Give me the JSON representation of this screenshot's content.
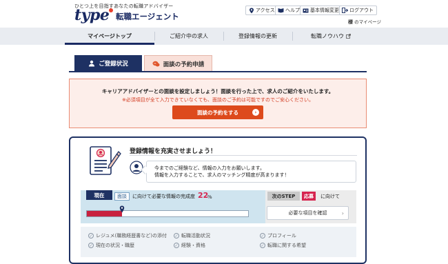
{
  "header": {
    "tagline": "ひとつ上を目指すあなたの転職アドバイザー",
    "logo_main": "type",
    "logo_sub": "転職エージェント",
    "buttons": [
      {
        "label": "アクセス",
        "icon": "map-pin-icon"
      },
      {
        "label": "ヘルプ",
        "icon": "book-icon"
      },
      {
        "label": "基本情報変更",
        "icon": "id-card-icon"
      },
      {
        "label": "ログアウト",
        "icon": "logout-icon"
      }
    ],
    "user_name": "様",
    "user_page": "のマイページ"
  },
  "nav": {
    "items": [
      "マイページトップ",
      "ご紹介中の求人",
      "登録情報の更新",
      "転職ノウハウ"
    ],
    "active": "マイページトップ"
  },
  "tabs": {
    "tab1": "ご登録状況",
    "tab2": "面談の予約申請"
  },
  "notice": {
    "line1": "キャリアアドバイザーとの面談を設定しましょう！面談を行った上で、求人のご紹介をいたします。",
    "line2": "※必須項目が全て入力できていなくても、面談のご予約は可能ですのでご安心ください。",
    "button": "面談の予約をする",
    "button_arrow": "›"
  },
  "card": {
    "title": "登録情報を充実させましょう！",
    "bubble_line1": "今までのご経験など、情報の入力をお願いします。",
    "bubble_line2": "情報を入力することで、求人のマッチング精度が高まります！"
  },
  "progress": {
    "now_label": "現在",
    "stage_tag": "面談",
    "text": "に向けて必要な情報の完成度",
    "percent_value": "22",
    "percent_sign": "%",
    "fraction": 0.22
  },
  "next": {
    "label": "次のSTEP",
    "stage_tag": "応募",
    "text": "に向けて",
    "button": "必要な項目を確認",
    "button_arrow": "›"
  },
  "checklist": [
    "レジュメ(職務経歴書など)の添付",
    "転職活動状況",
    "プロフィール",
    "現在の状況・職歴",
    "経験・資格",
    "転職に関する希望"
  ],
  "colors": {
    "navy": "#1e3163",
    "accent_orange": "#dd4a1c",
    "accent_red": "#d6244f",
    "notice_bg": "#fdeeea"
  }
}
